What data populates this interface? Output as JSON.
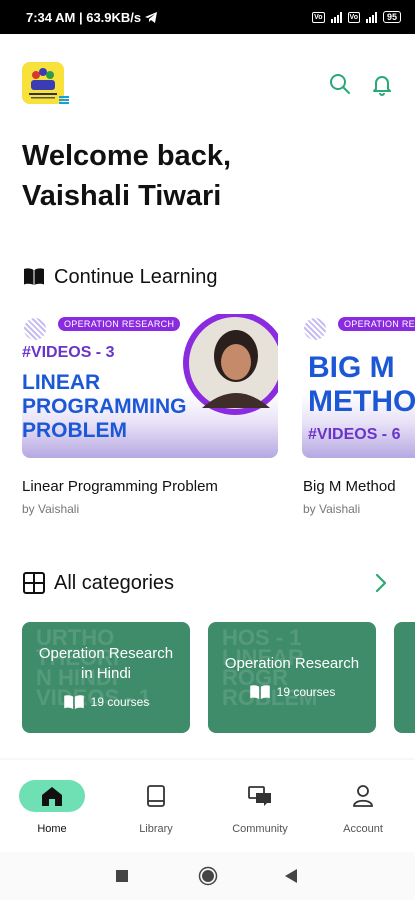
{
  "status_bar": {
    "time_speed": "7:34 AM | 63.9KB/s",
    "battery": "95"
  },
  "header": {
    "welcome": "Welcome back,",
    "user_name": "Vaishali Tiwari"
  },
  "continue_learning": {
    "title": "Continue Learning",
    "courses": [
      {
        "tag": "OPERATION RESEARCH",
        "video_label": "#VIDEOS - 3",
        "thumb_line1": "LINEAR",
        "thumb_line2": "PROGRAMMING",
        "thumb_line3": "PROBLEM",
        "title": "Linear Programming Problem",
        "author": "by Vaishali"
      },
      {
        "tag": "OPERATION RESEARCH",
        "video_label": "#VIDEOS - 6",
        "thumb_line1": "BIG M",
        "thumb_line2": "METHOD",
        "title": "Big M Method",
        "author": "by Vaishali"
      }
    ]
  },
  "categories": {
    "title": "All categories",
    "items": [
      {
        "name_line1": "Operation Research",
        "name_line2": "in Hindi",
        "count": "19 courses"
      },
      {
        "name_line1": "Operation Research",
        "count": "19 courses"
      }
    ]
  },
  "bottom_nav": {
    "items": [
      {
        "label": "Home",
        "icon": "home-icon",
        "active": true
      },
      {
        "label": "Library",
        "icon": "book-icon"
      },
      {
        "label": "Community",
        "icon": "chat-icon"
      },
      {
        "label": "Account",
        "icon": "person-icon"
      }
    ]
  },
  "colors": {
    "accent": "#2aa876",
    "nav_active": "#6fe0b3",
    "category_card": "#3f8c6a",
    "tag_purple": "#8b2be0",
    "thumb_blue": "#1c58d6"
  }
}
